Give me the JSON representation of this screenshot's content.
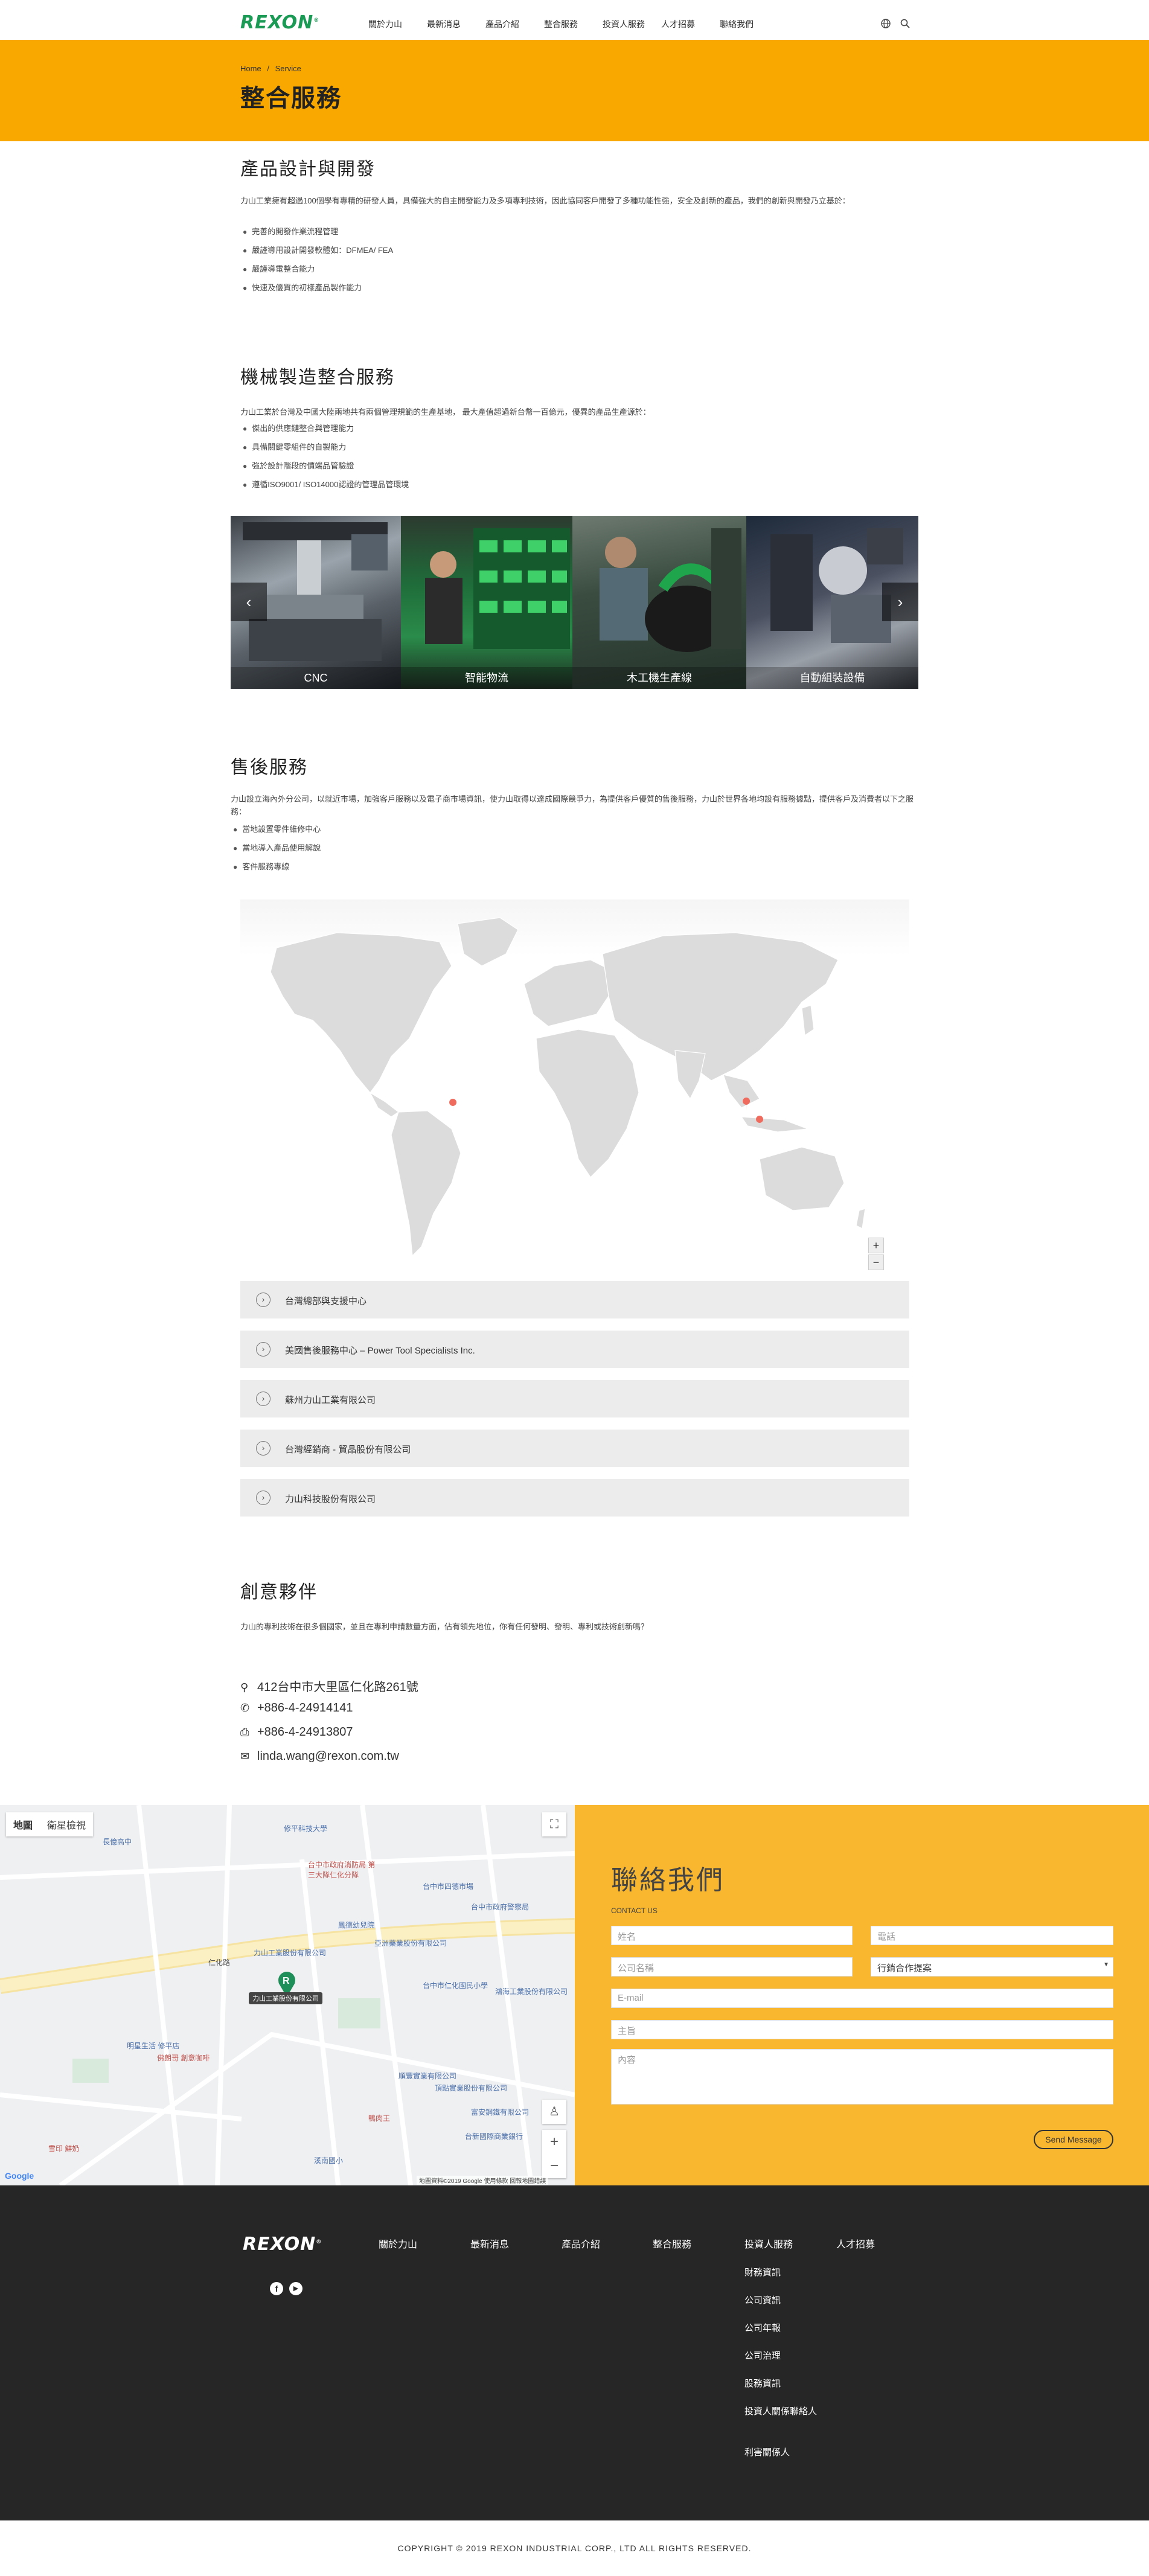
{
  "header": {
    "logo": "REXON",
    "logo_mark": "®",
    "nav": [
      "關於力山",
      "最新消息",
      "產品介紹",
      "整合服務",
      "投資人服務",
      "人才招募",
      "聯絡我們"
    ]
  },
  "banner": {
    "breadcrumb_home": "Home",
    "breadcrumb_sep": "/",
    "breadcrumb_current": "Service",
    "title": "整合服務"
  },
  "design": {
    "title": "產品設計與開發",
    "intro": "力山工業擁有超過100個學有專精的研發人員，具備強大的自主開發能力及多項專利技術，因此協同客戶開發了多種功能性強，安全及創新的產品，我們的創新與開發乃立基於：",
    "bullets": [
      "完善的開發作業流程管理",
      "嚴謹導用設計開發軟體如：DFMEA/ FEA",
      "嚴謹導電整合能力",
      "快速及優質的初樣產品製作能力"
    ]
  },
  "manufacturing": {
    "title": "機械製造整合服務",
    "intro": "力山工業於台灣及中國大陸兩地共有兩個管理規範的生產基地， 最大產值超過新台幣一百億元，優異的產品生產源於：",
    "bullets": [
      "傑出的供應鏈整合與管理能力",
      "具備關鍵零組件的自製能力",
      "強於設計階段的價端品管驗證",
      "遵循ISO9001/ ISO14000認證的管理品管環境"
    ]
  },
  "carousel": {
    "slides": [
      "CNC",
      "智能物流",
      "木工機生產線",
      "自動組裝設備"
    ],
    "prev": "‹",
    "next": "›"
  },
  "after_sales": {
    "title": "售後服務",
    "intro": "力山設立海內外分公司，以就近市場，加強客戶服務以及電子商市場資訊，使力山取得以達成國際競爭力，為提供客戶優質的售後服務，力山於世界各地均設有服務據點，提供客戶及消費者以下之服務：",
    "bullets": [
      "當地設置零件維修中心",
      "當地導入產品使用解說",
      "客件服務專線"
    ]
  },
  "world_map": {
    "zoom_in": "+",
    "zoom_out": "−"
  },
  "locations": [
    "台灣總部與支援中心",
    "美國售後服務中心 – Power Tool Specialists Inc.",
    "蘇州力山工業有限公司",
    "台灣經銷商 - 貿晶股份有限公司",
    "力山科技股份有限公司"
  ],
  "partner": {
    "title": "創意夥伴",
    "intro": "力山的專利技術在很多個國家，並且在專利申請數量方面，佔有領先地位，你有任何發明、發明、專利或技術創新嗎？"
  },
  "contact_info": {
    "address": "412台中市大里區仁化路261號",
    "phone": "+886-4-24914141",
    "fax": "+886-4-24913807",
    "email": "linda.wang@rexon.com.tw",
    "icons": [
      "map-pin-icon",
      "phone-icon",
      "printer-icon",
      "mail-icon"
    ]
  },
  "map": {
    "tab_map": "地圖",
    "tab_satellite": "衛星檢視",
    "marker_label": "力山工業股份有限公司",
    "road": "仁化路",
    "pois": [
      "修平科技大學",
      "長億高中",
      "台中市政府消防局 第三大隊仁化分隊",
      "台中市四德市場",
      "台中市政府警察局",
      "鳳德幼兒院",
      "亞洲藥業股份有限公司",
      "台中市仁化國民小學",
      "力山工業股份有限公司",
      "明星生活 修平店",
      "佛朗哥 創意咖啡",
      "頂點實業股份有限公司",
      "富安鋼鐵有限公司",
      "台新國際商業銀行",
      "鴻海工業股份有限公司",
      "順豐實業有限公司",
      "鴨肉王",
      "溪南國小",
      "雪印 鮮奶"
    ],
    "footer_text": "地圖資料©2019 Google  使用條款  回報地圖錯誤"
  },
  "contact_form": {
    "title": "聯絡我們",
    "subtitle": "CONTACT US",
    "name_ph": "姓名",
    "phone_ph": "電話",
    "company_ph": "公司名稱",
    "category": "行銷合作提案",
    "email_ph": "E-mail",
    "subject_ph": "主旨",
    "content_ph": "內容",
    "send": "Send Message"
  },
  "footer": {
    "logo": "REXON",
    "logo_mark": "®",
    "columns": [
      "關於力山",
      "最新消息",
      "產品介紹",
      "整合服務",
      "投資人服務",
      "人才招募"
    ],
    "investor_links": [
      "財務資訊",
      "公司資訊",
      "公司年報",
      "公司治理",
      "股務資訊",
      "投資人關係聯絡人",
      "利害關係人"
    ],
    "copyright": "COPYRIGHT © 2019 REXON INDUSTRIAL CORP., LTD ALL RIGHTS RESERVED."
  },
  "colors": {
    "brand_green": "#1a9a55",
    "banner_yellow": "#f9a800",
    "form_yellow": "#f9b730",
    "footer_dark": "#262626"
  }
}
